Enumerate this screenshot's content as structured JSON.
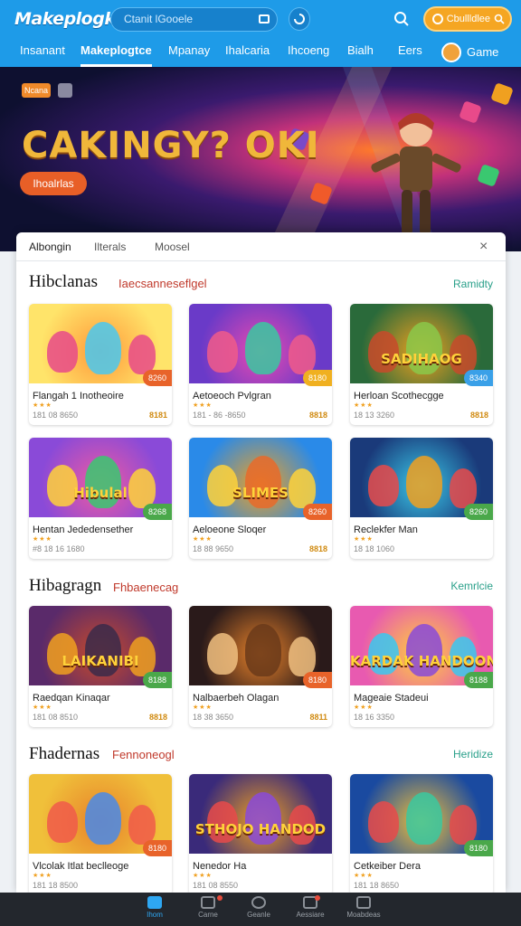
{
  "app": {
    "logo": "Makeplogkt"
  },
  "search": {
    "placeholder": "Ctanit lGooele"
  },
  "account": {
    "points_label": "Cbullldlee"
  },
  "nav": {
    "items": [
      "Insanant",
      "Makeplogtce",
      "Mpanay",
      "Ihalcaria",
      "Ihcoeng",
      "Bialh",
      "Eers"
    ],
    "active_index": 1,
    "game_label": "Game"
  },
  "hero": {
    "tag": "Ncana",
    "title": "CAKINGY? OKI",
    "cta": "Ihoalrlas"
  },
  "panel": {
    "tabs": [
      "Albongin",
      "Ilterals",
      "Moosel"
    ],
    "close_symbol": "×"
  },
  "sections": [
    {
      "title": "Hibclanas",
      "subtitle": "Iaecsanneseflgel",
      "link": "Ramidty",
      "cards": [
        {
          "name": "Flangah 1 Inotheoire",
          "meta": "181 08 8650",
          "price": "8181",
          "badge": "8260",
          "badge_color": "#e8632a",
          "theme": "candy"
        },
        {
          "name": "Aetoeoch Pvlgran",
          "meta": "181 - 86 -8650",
          "price": "8818",
          "badge": "8180",
          "badge_color": "#f0b020",
          "theme": "dance"
        },
        {
          "name": "Herloan Scothecgge",
          "meta": "18 13 3260",
          "price": "8818",
          "badge": "8340",
          "badge_color": "#3aa0e8",
          "theme": "sadihaog",
          "thumb_title": "SADIHAOG"
        }
      ]
    },
    {
      "title": "",
      "subtitle": "",
      "link": "",
      "cards": [
        {
          "name": "Hentan Jededensether",
          "meta": "#8 18 16 1680",
          "price": "",
          "badge": "8268",
          "badge_color": "#4aa84a",
          "theme": "hibulal",
          "thumb_title": "Hibulal"
        },
        {
          "name": "Aeloeone Sloqer",
          "meta": "18 88 9650",
          "price": "8818",
          "badge": "8260",
          "badge_color": "#e8632a",
          "theme": "slimes",
          "thumb_title": "SLIMES"
        },
        {
          "name": "Reclekfer Man",
          "meta": "18 18 1060",
          "price": "",
          "badge": "8260",
          "badge_color": "#4aa84a",
          "theme": "party"
        }
      ]
    },
    {
      "title": "Hibagragn",
      "subtitle": "Fhbaenecag",
      "link": "Kemrlcie",
      "cards": [
        {
          "name": "Raedqan Kinaqar",
          "meta": "181 08 8510",
          "price": "8818",
          "badge": "8188",
          "badge_color": "#4aa84a",
          "theme": "heist",
          "thumb_title": "LAIKANIBI"
        },
        {
          "name": "Nalbaerbeh Olagan",
          "meta": "18 38 3650",
          "price": "8811",
          "badge": "8180",
          "badge_color": "#e8632a",
          "theme": "bear"
        },
        {
          "name": "Mageaie Stadeui",
          "meta": "18 16 3350",
          "price": "",
          "badge": "8188",
          "badge_color": "#4aa84a",
          "theme": "kardak",
          "thumb_title": "KARDAK HANDOON"
        }
      ]
    },
    {
      "title": "Fhadernas",
      "subtitle": "Fennoneogl",
      "link": "Heridize",
      "cards": [
        {
          "name": "Vlcolak Itlat beclleoge",
          "meta": "181 18 8500",
          "price": "",
          "badge": "8180",
          "badge_color": "#e8632a",
          "theme": "fox"
        },
        {
          "name": "Nenedor Ha",
          "meta": "181 08 8550",
          "price": "",
          "badge": "",
          "badge_color": "#4aa84a",
          "theme": "stardo",
          "thumb_title": "STHOJO HANDOD"
        },
        {
          "name": "Cetkeiber Dera",
          "meta": "181 18 8650",
          "price": "",
          "badge": "8180",
          "badge_color": "#4aa84a",
          "theme": "ocean"
        }
      ]
    }
  ],
  "bottom_nav": [
    {
      "label": "Ihom",
      "icon": "home-icon",
      "active": true
    },
    {
      "label": "Carne",
      "icon": "gamepad-icon",
      "active": false,
      "dot": true
    },
    {
      "label": "Geanle",
      "icon": "clock-icon",
      "active": false
    },
    {
      "label": "Aessiare",
      "icon": "bag-icon",
      "active": false,
      "dot": true
    },
    {
      "label": "Moabdeas",
      "icon": "stats-icon",
      "active": false
    }
  ],
  "colors": {
    "primary": "#1e9be8",
    "accent": "#f5a623",
    "cta": "#e85f27",
    "link": "#2aa08a",
    "subtitle": "#c0392b",
    "bottom_bar": "#23272d"
  }
}
